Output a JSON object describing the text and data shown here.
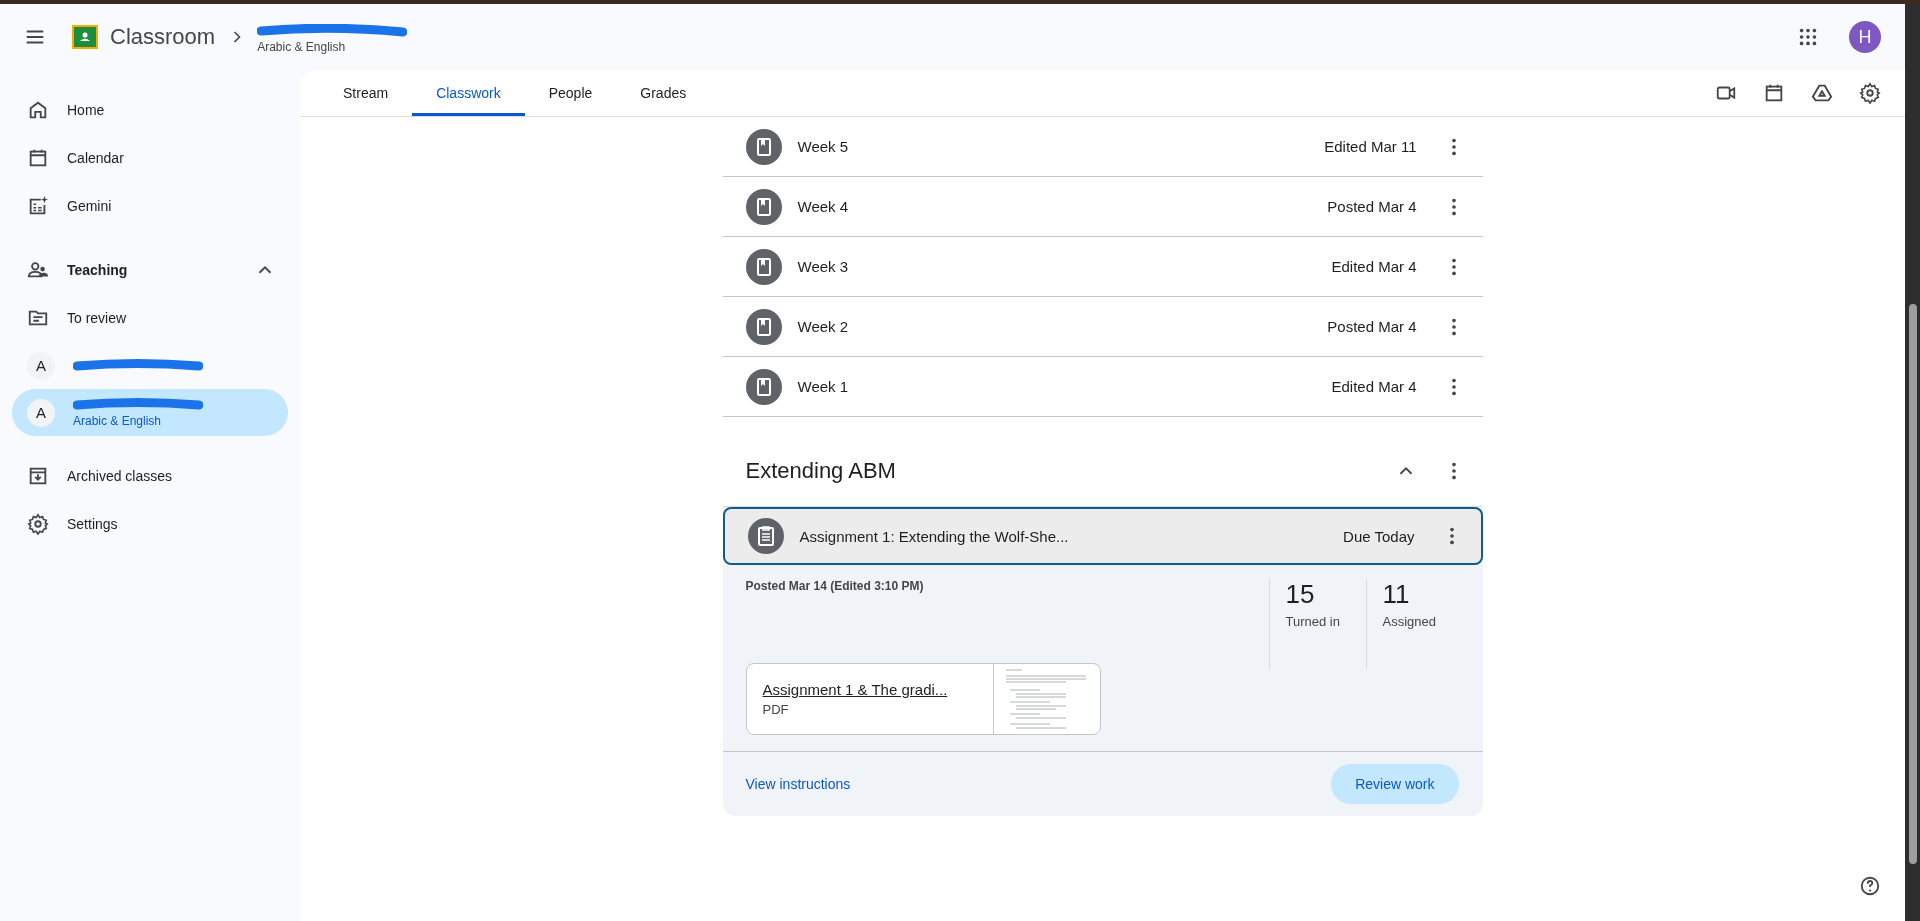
{
  "header": {
    "app_name": "Classroom",
    "class_subtitle": "Arabic & English",
    "avatar_letter": "H"
  },
  "sidebar": {
    "top_links": [
      {
        "label": "Home"
      },
      {
        "label": "Calendar"
      },
      {
        "label": "Gemini"
      }
    ],
    "teaching": {
      "label": "Teaching",
      "expanded": true,
      "links": [
        {
          "label": "To review"
        }
      ],
      "classes": [
        {
          "letter": "A",
          "selected": false
        },
        {
          "letter": "A",
          "subtitle": "Arabic & English",
          "selected": true
        }
      ]
    },
    "bottom_links": [
      {
        "label": "Archived classes"
      },
      {
        "label": "Settings"
      }
    ]
  },
  "tabs": [
    {
      "label": "Stream",
      "selected": false
    },
    {
      "label": "Classwork",
      "selected": true
    },
    {
      "label": "People",
      "selected": false
    },
    {
      "label": "Grades",
      "selected": false
    }
  ],
  "topics": [
    {
      "title": "Week 5",
      "status": "Edited Mar 11"
    },
    {
      "title": "Week 4",
      "status": "Posted Mar 4"
    },
    {
      "title": "Week 3",
      "status": "Edited Mar 4"
    },
    {
      "title": "Week 2",
      "status": "Posted Mar 4"
    },
    {
      "title": "Week 1",
      "status": "Edited Mar 4"
    }
  ],
  "section": {
    "title": "Extending ABM",
    "expanded": true,
    "assignment": {
      "title": "Assignment 1: Extending the Wolf-She...",
      "due": "Due Today",
      "selected": true,
      "posted": "Posted Mar 14 (Edited 3:10 PM)",
      "stats": [
        {
          "value": "15",
          "label": "Turned in"
        },
        {
          "value": "11",
          "label": "Assigned"
        }
      ],
      "attachment": {
        "title": "Assignment 1 & The gradi...",
        "type": "PDF"
      },
      "link": "View instructions",
      "button": "Review work"
    }
  }
}
